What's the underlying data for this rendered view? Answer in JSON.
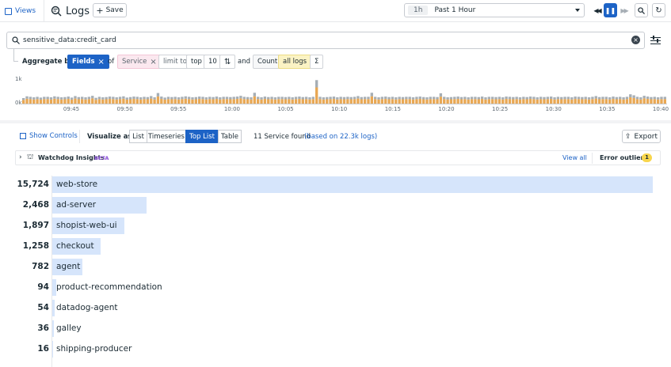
{
  "header": {
    "views_label": "Views",
    "title": "Logs",
    "save_label": "Save",
    "time_short": "1h",
    "time_range": "Past 1 Hour"
  },
  "search": {
    "query": "sensitive_data:credit_card"
  },
  "aggregate": {
    "label": "Aggregate by",
    "fields": "Fields",
    "of": "of",
    "service": "Service",
    "limit_to": "limit to",
    "top": "top",
    "count_num": "10",
    "and": "and",
    "count": "Count",
    "all_logs": "all logs",
    "sigma": "Σ"
  },
  "histogram": {
    "y_top": "1k",
    "y_bottom": "0k",
    "ticks": [
      "09:45",
      "09:50",
      "09:55",
      "10:00",
      "10:05",
      "10:10",
      "10:15",
      "10:20",
      "10:25",
      "10:30",
      "10:35",
      "10:40"
    ],
    "bars": [
      0.25,
      0.32,
      0.3,
      0.28,
      0.3,
      0.27,
      0.3,
      0.3,
      0.28,
      0.32,
      0.3,
      0.28,
      0.29,
      0.31,
      0.27,
      0.33,
      0.29,
      0.3,
      0.28,
      0.3,
      0.34,
      0.26,
      0.3,
      0.28,
      0.29,
      0.31,
      0.3,
      0.28,
      0.3,
      0.32,
      0.27,
      0.29,
      0.31,
      0.3,
      0.28,
      0.3,
      0.29,
      0.33,
      0.28,
      0.45,
      0.31,
      0.27,
      0.3,
      0.29,
      0.3,
      0.28,
      0.3,
      0.32,
      0.3,
      0.28,
      0.29,
      0.31,
      0.3,
      0.28,
      0.3,
      0.29,
      0.31,
      0.28,
      0.3,
      0.3,
      0.29,
      0.3,
      0.31,
      0.34,
      0.3,
      0.29,
      0.28,
      0.46,
      0.3,
      0.28,
      0.31,
      0.29,
      0.3,
      0.28,
      0.3,
      0.3,
      0.29,
      0.3,
      0.28,
      0.3,
      0.31,
      0.29,
      0.3,
      0.28,
      0.3,
      0.96,
      0.3,
      0.28,
      0.29,
      0.3,
      0.31,
      0.28,
      0.3,
      0.29,
      0.3,
      0.29,
      0.3,
      0.33,
      0.29,
      0.3,
      0.3,
      0.46,
      0.3,
      0.28,
      0.3,
      0.31,
      0.29,
      0.3,
      0.28,
      0.3,
      0.29,
      0.3,
      0.3,
      0.28,
      0.3,
      0.31,
      0.29,
      0.28,
      0.3,
      0.3,
      0.29,
      0.44,
      0.3,
      0.28,
      0.29,
      0.3,
      0.31,
      0.29,
      0.3,
      0.28,
      0.3,
      0.3,
      0.29,
      0.31,
      0.28,
      0.3,
      0.3,
      0.29,
      0.3,
      0.28,
      0.31,
      0.3,
      0.29,
      0.3,
      0.28,
      0.3,
      0.29,
      0.31,
      0.3,
      0.28,
      0.3,
      0.29,
      0.3,
      0.31,
      0.28,
      0.3,
      0.29,
      0.3,
      0.3,
      0.28,
      0.31,
      0.3,
      0.29,
      0.3,
      0.28,
      0.3,
      0.33,
      0.29,
      0.3,
      0.3,
      0.28,
      0.31,
      0.29,
      0.3,
      0.28,
      0.3,
      0.4,
      0.36,
      0.3,
      0.28,
      0.34,
      0.31,
      0.29,
      0.3,
      0.28,
      0.3,
      0.3
    ],
    "orange_ratio": 0.7
  },
  "controls": {
    "show_controls": "Show Controls",
    "visualize_as": "Visualize as",
    "tabs": [
      "List",
      "Timeseries",
      "Top List",
      "Table"
    ],
    "active_tab": "Top List",
    "summary": "11 Service found",
    "summary_link": "(based on 22.3k logs)",
    "export": "Export"
  },
  "insights": {
    "title": "Watchdog Insights",
    "beta": "BETA",
    "view_all": "View all",
    "error_outliers": "Error outliers",
    "outlier_count": "1"
  },
  "toplist": {
    "max": 15724,
    "rows": [
      {
        "value": 15724,
        "display": "15,724",
        "label": "web-store"
      },
      {
        "value": 2468,
        "display": "2,468",
        "label": "ad-server"
      },
      {
        "value": 1897,
        "display": "1,897",
        "label": "shopist-web-ui"
      },
      {
        "value": 1258,
        "display": "1,258",
        "label": "checkout"
      },
      {
        "value": 782,
        "display": "782",
        "label": "agent"
      },
      {
        "value": 94,
        "display": "94",
        "label": "product-recommendation"
      },
      {
        "value": 54,
        "display": "54",
        "label": "datadog-agent"
      },
      {
        "value": 36,
        "display": "36",
        "label": "galley"
      },
      {
        "value": 16,
        "display": "16",
        "label": "shipping-producer"
      }
    ]
  },
  "colors": {
    "accent": "#1d63c6",
    "bar_fill": "#d6e5fb",
    "hist_orange": "#e8a855",
    "hist_gray": "#a6aeb5",
    "pink_chip": "#fbe8ef"
  }
}
